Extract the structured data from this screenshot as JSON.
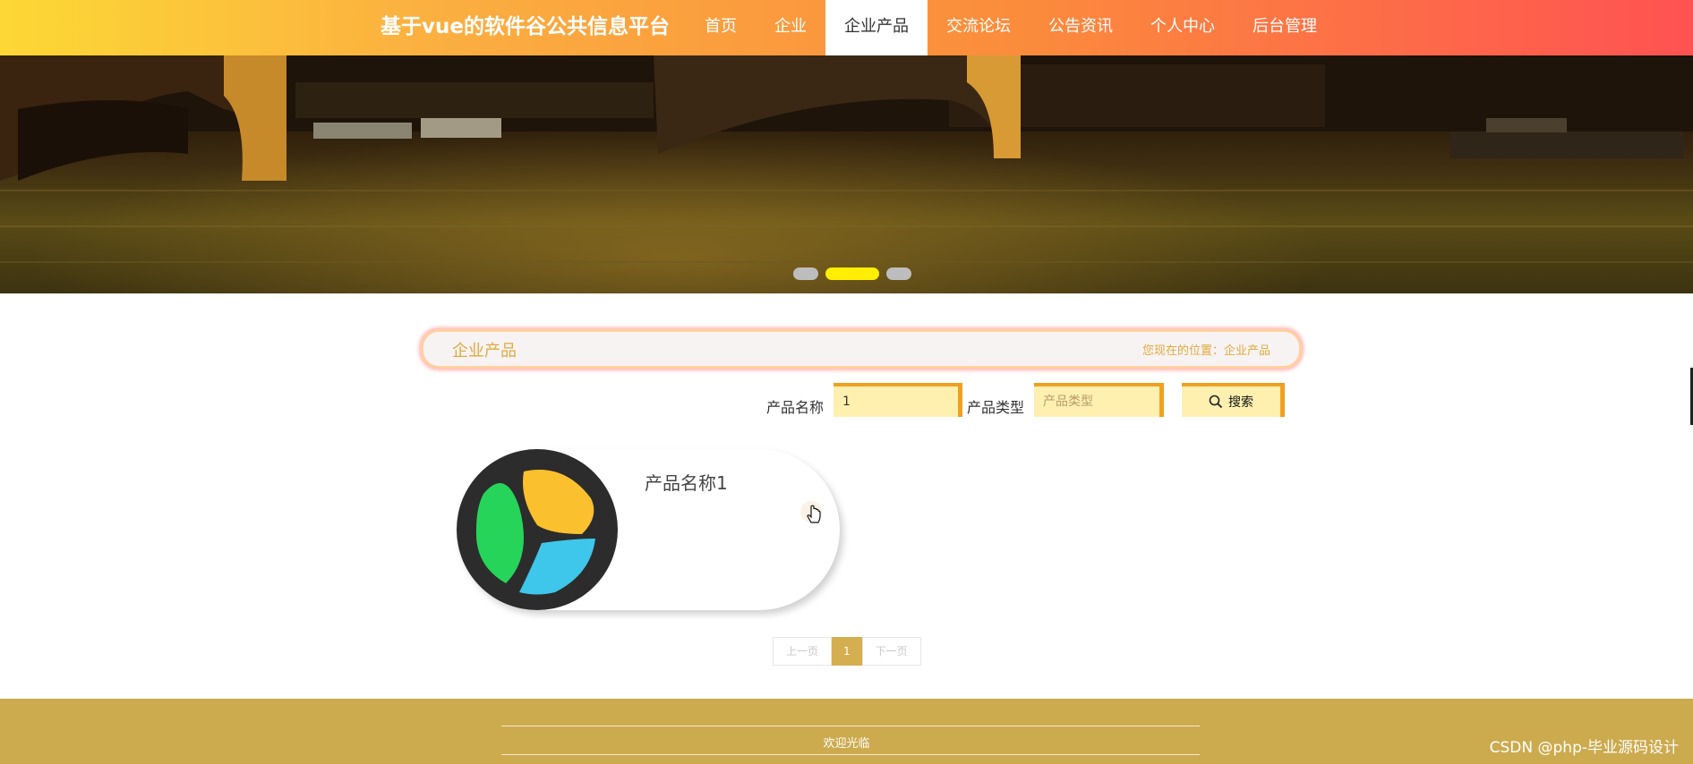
{
  "header": {
    "brand": "基于vue的软件谷公共信息平台",
    "nav": [
      {
        "label": "首页",
        "active": false
      },
      {
        "label": "企业",
        "active": false
      },
      {
        "label": "企业产品",
        "active": true
      },
      {
        "label": "交流论坛",
        "active": false
      },
      {
        "label": "公告资讯",
        "active": false
      },
      {
        "label": "个人中心",
        "active": false
      },
      {
        "label": "后台管理",
        "active": false
      }
    ]
  },
  "banner": {
    "slide_count": 3,
    "active_slide": 2
  },
  "section": {
    "title": "企业产品",
    "location": "您现在的位置：企业产品"
  },
  "search": {
    "name_label": "产品名称",
    "name_value": "1",
    "type_label": "产品类型",
    "type_placeholder": "产品类型",
    "button_label": "搜索",
    "button_icon": "search-icon"
  },
  "products": [
    {
      "name": "产品名称1",
      "logo_icon": "tri-leaf-logo-icon"
    }
  ],
  "pagination": {
    "prev": "上一页",
    "current": "1",
    "next": "下一页"
  },
  "footer": {
    "welcome": "欢迎光临"
  },
  "watermark": "CSDN @php-毕业源码设计",
  "colors": {
    "accent": "#d4ae4f",
    "footer": "#ccaa4e",
    "title_text": "#e0aa3e",
    "input_bg": "#fff0b0",
    "input_border": "#f0a020"
  }
}
